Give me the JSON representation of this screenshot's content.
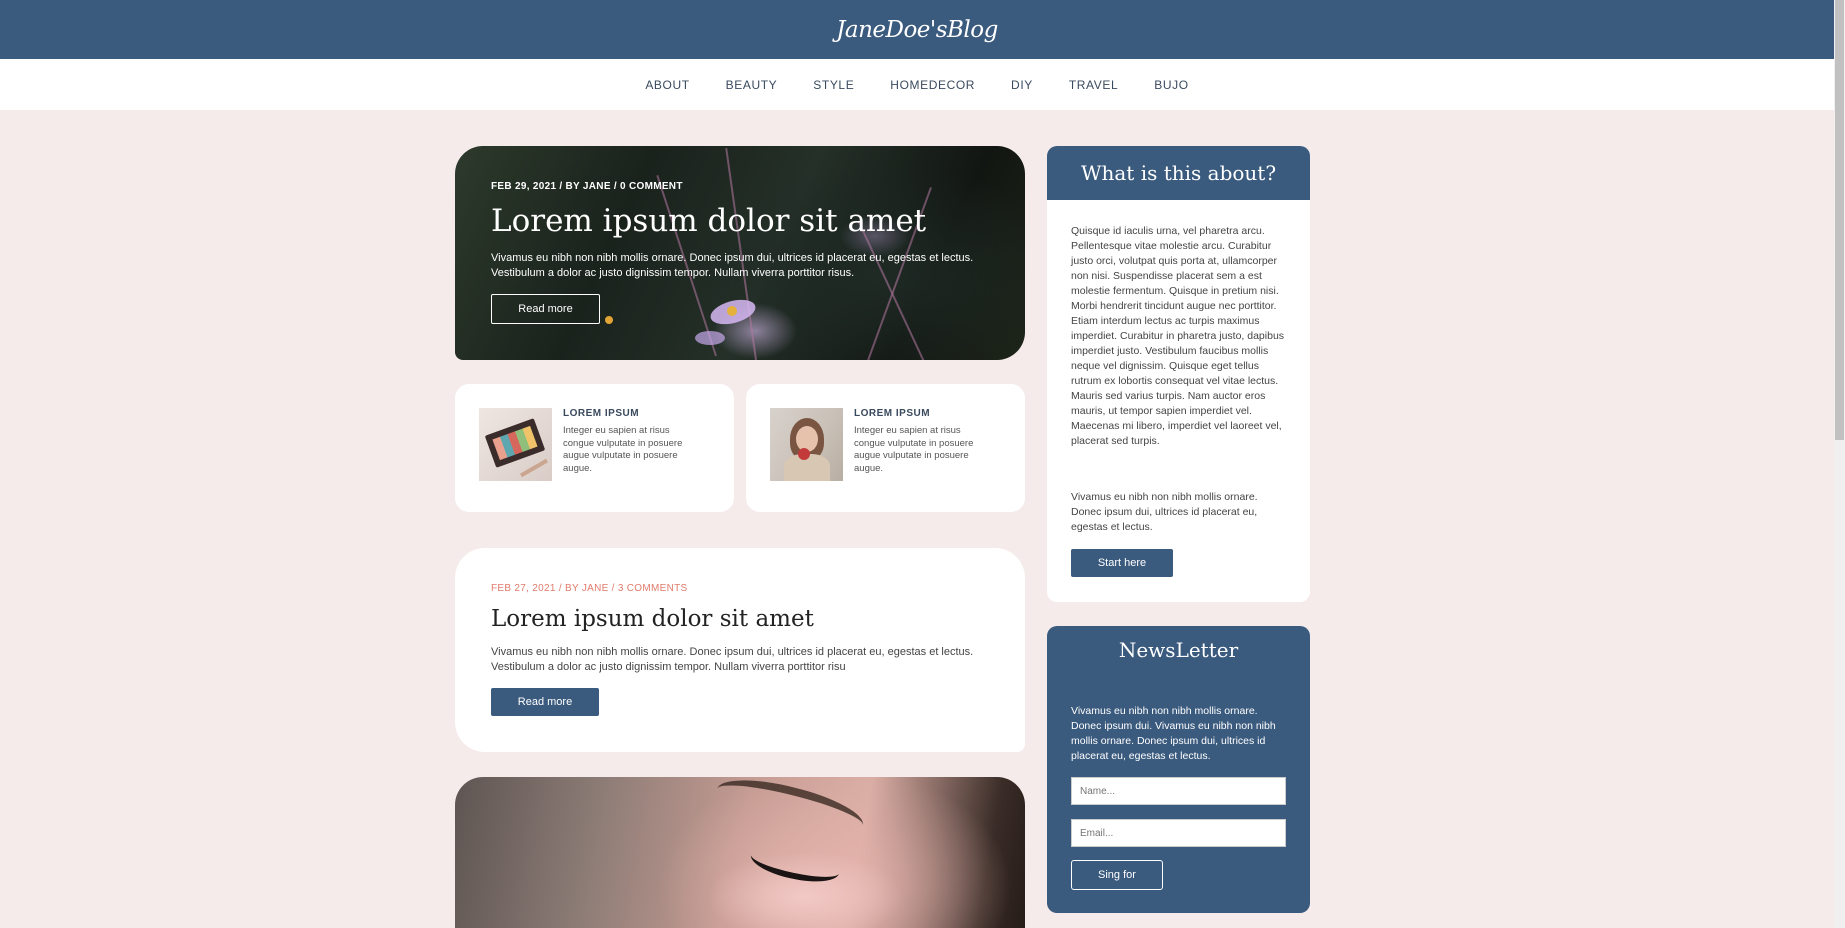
{
  "site": {
    "logo": "JaneDoe'sBlog"
  },
  "nav": {
    "items": [
      "ABOUT",
      "BEAUTY",
      "STYLE",
      "HOMEDECOR",
      "DIY",
      "TRAVEL",
      "BUJO"
    ]
  },
  "hero": {
    "meta": "FEB 29, 2021 / BY JANE / 0 COMMENT",
    "title": "Lorem ipsum dolor sit amet",
    "excerpt": "Vivamus eu nibh non nibh mollis ornare. Donec ipsum dui, ultrices id placerat eu, egestas et lectus. Vestibulum a dolor ac justo dignissim tempor. Nullam viverra porttitor risus.",
    "button": "Read more"
  },
  "mini_cards": [
    {
      "label": "LOREM IPSUM",
      "text": "Integer eu sapien at risus congue vulputate in posuere augue vulputate in posuere augue."
    },
    {
      "label": "LOREM IPSUM",
      "text": "Integer eu sapien at risus congue vulputate in posuere augue vulputate in posuere augue."
    }
  ],
  "post": {
    "meta": "FEB 27, 2021 / BY JANE / 3 COMMENTS",
    "title": "Lorem ipsum dolor sit amet",
    "excerpt": "Vivamus eu nibh non nibh mollis ornare. Donec ipsum dui, ultrices id placerat eu, egestas et lectus. Vestibulum a dolor ac justo dignissim tempor. Nullam viverra porttitor risu",
    "button": "Read more"
  },
  "about": {
    "title": "What is this about?",
    "p1": "Quisque id iaculis urna, vel pharetra arcu. Pellentesque vitae molestie arcu. Curabitur justo orci, volutpat quis porta at, ullamcorper non nisi. Suspendisse placerat sem a est molestie fermentum. Quisque in pretium nisi. Morbi hendrerit tincidunt augue nec porttitor. Etiam interdum lectus ac turpis maximus imperdiet. Curabitur in pharetra justo, dapibus imperdiet justo. Vestibulum faucibus mollis neque vel dignissim. Quisque eget tellus rutrum ex lobortis consequat vel vitae lectus. Mauris sed varius turpis. Nam auctor eros mauris, ut tempor sapien imperdiet vel. Maecenas mi libero, imperdiet vel laoreet vel, placerat sed turpis.",
    "p2": "Vivamus eu nibh non nibh mollis ornare. Donec ipsum dui, ultrices id placerat eu, egestas et lectus.",
    "button": "Start here"
  },
  "newsletter": {
    "title": "NewsLetter",
    "text": "Vivamus eu nibh non nibh mollis ornare. Donec ipsum dui. Vivamus eu nibh non nibh mollis ornare. Donec ipsum dui, ultrices id placerat eu, egestas et lectus.",
    "name_placeholder": "Name...",
    "email_placeholder": "Email...",
    "button": "Sing for"
  },
  "colors": {
    "primary": "#3a5a7e",
    "background": "#f6ebeb",
    "accent_meta": "#e07b6b"
  }
}
